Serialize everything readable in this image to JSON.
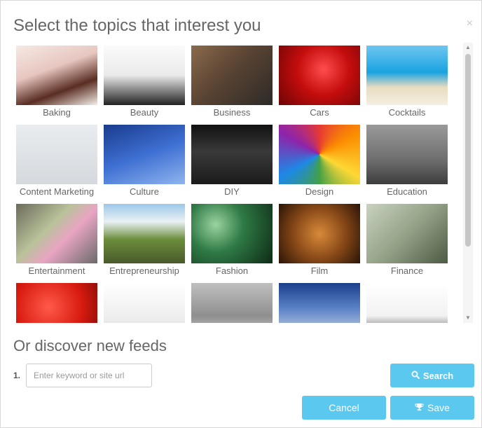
{
  "dialog": {
    "title": "Select the topics that interest you",
    "close_icon": "×"
  },
  "topics": [
    {
      "label": "Baking",
      "image": "pastries-photo"
    },
    {
      "label": "Beauty",
      "image": "makeup-brushes-photo"
    },
    {
      "label": "Business",
      "image": "laptop-desk-photo"
    },
    {
      "label": "Cars",
      "image": "red-classic-car-photo"
    },
    {
      "label": "Cocktails",
      "image": "beach-cocktail-photo"
    },
    {
      "label": "Content Marketing",
      "image": "add-new-post-screen-photo"
    },
    {
      "label": "Culture",
      "image": "totem-sign-photo"
    },
    {
      "label": "DIY",
      "image": "drill-bit-photo"
    },
    {
      "label": "Design",
      "image": "colored-pencils-photo"
    },
    {
      "label": "Education",
      "image": "apple-on-books-photo"
    },
    {
      "label": "Entertainment",
      "image": "painted-guitar-photo"
    },
    {
      "label": "Entrepreneurship",
      "image": "wooden-bridge-photo"
    },
    {
      "label": "Fashion",
      "image": "high-heel-shoe-photo"
    },
    {
      "label": "Film",
      "image": "vintage-camera-photo"
    },
    {
      "label": "Finance",
      "image": "dollar-bills-photo"
    },
    {
      "label": "",
      "image": "tomatoes-photo"
    },
    {
      "label": "",
      "image": "chess-pieces-photo"
    },
    {
      "label": "",
      "image": "measuring-tape-photo"
    },
    {
      "label": "",
      "image": "courthouse-photo"
    },
    {
      "label": "",
      "image": "business-handshake-photo"
    }
  ],
  "discover": {
    "heading": "Or discover new feeds",
    "number": "1.",
    "input_placeholder": "Enter keyword or site url",
    "input_value": "",
    "search_label": "Search",
    "search_icon": "search-icon"
  },
  "actions": {
    "cancel_label": "Cancel",
    "save_label": "Save",
    "save_icon": "trophy-icon"
  },
  "colors": {
    "button": "#5bc8ef",
    "title_text": "#666666",
    "label_text": "#666666"
  }
}
